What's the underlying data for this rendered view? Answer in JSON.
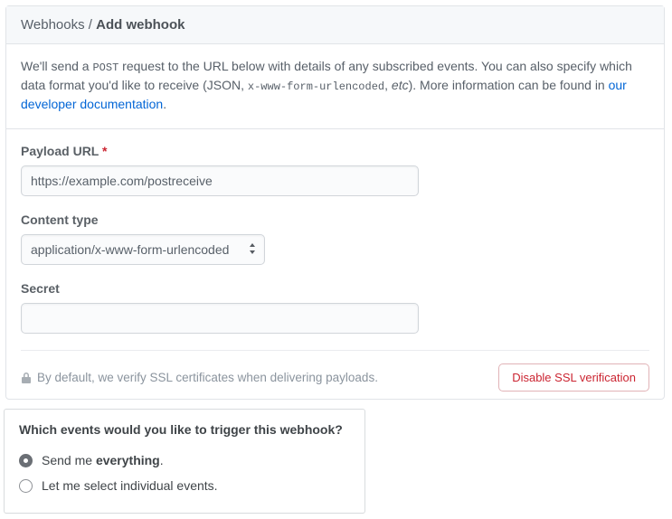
{
  "header": {
    "crumb": "Webhooks",
    "sep": " / ",
    "current": "Add webhook"
  },
  "intro": {
    "pre": "We'll send a ",
    "method": "POST",
    "mid1": " request to the URL below with details of any subscribed events. You can also specify which data format you'd like to receive (JSON, ",
    "enc": "x-www-form-urlencoded",
    "mid2": ", ",
    "etc": "etc",
    "mid3": "). More information can be found in ",
    "link": "our developer documentation",
    "tail": "."
  },
  "form": {
    "payload_label": "Payload URL",
    "payload_value": "https://example.com/postreceive",
    "content_type_label": "Content type",
    "content_type_value": "application/x-www-form-urlencoded",
    "secret_label": "Secret",
    "secret_value": ""
  },
  "ssl": {
    "text": "By default, we verify SSL certificates when delivering payloads.",
    "button": "Disable SSL verification"
  },
  "events": {
    "title": "Which events would you like to trigger this webhook?",
    "opt1_pre": "Send me ",
    "opt1_strong": "everything",
    "opt1_post": ".",
    "opt2": "Let me select individual events."
  }
}
